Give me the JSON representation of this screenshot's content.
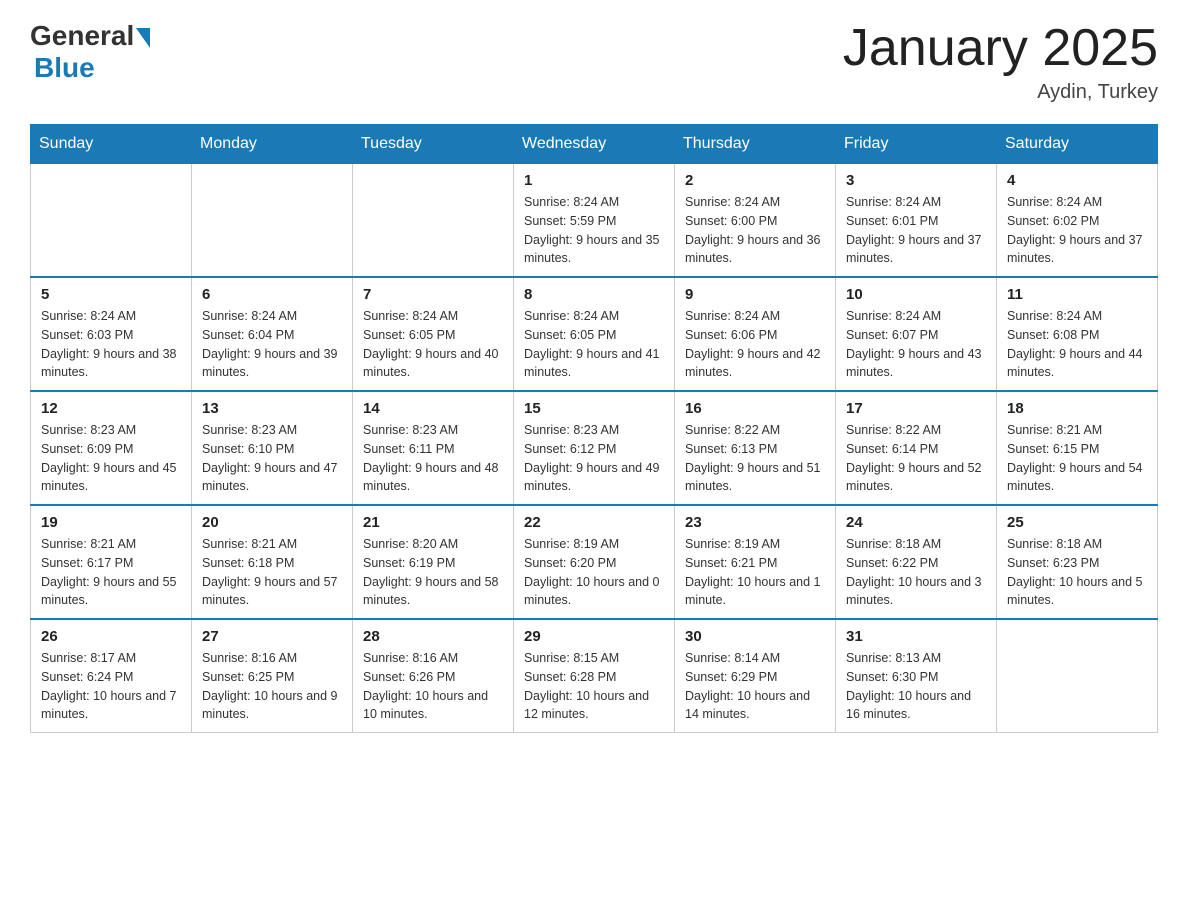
{
  "header": {
    "logo_general": "General",
    "logo_blue": "Blue",
    "month_title": "January 2025",
    "location": "Aydin, Turkey"
  },
  "days_of_week": [
    "Sunday",
    "Monday",
    "Tuesday",
    "Wednesday",
    "Thursday",
    "Friday",
    "Saturday"
  ],
  "weeks": [
    [
      {
        "day": "",
        "info": ""
      },
      {
        "day": "",
        "info": ""
      },
      {
        "day": "",
        "info": ""
      },
      {
        "day": "1",
        "info": "Sunrise: 8:24 AM\nSunset: 5:59 PM\nDaylight: 9 hours and 35 minutes."
      },
      {
        "day": "2",
        "info": "Sunrise: 8:24 AM\nSunset: 6:00 PM\nDaylight: 9 hours and 36 minutes."
      },
      {
        "day": "3",
        "info": "Sunrise: 8:24 AM\nSunset: 6:01 PM\nDaylight: 9 hours and 37 minutes."
      },
      {
        "day": "4",
        "info": "Sunrise: 8:24 AM\nSunset: 6:02 PM\nDaylight: 9 hours and 37 minutes."
      }
    ],
    [
      {
        "day": "5",
        "info": "Sunrise: 8:24 AM\nSunset: 6:03 PM\nDaylight: 9 hours and 38 minutes."
      },
      {
        "day": "6",
        "info": "Sunrise: 8:24 AM\nSunset: 6:04 PM\nDaylight: 9 hours and 39 minutes."
      },
      {
        "day": "7",
        "info": "Sunrise: 8:24 AM\nSunset: 6:05 PM\nDaylight: 9 hours and 40 minutes."
      },
      {
        "day": "8",
        "info": "Sunrise: 8:24 AM\nSunset: 6:05 PM\nDaylight: 9 hours and 41 minutes."
      },
      {
        "day": "9",
        "info": "Sunrise: 8:24 AM\nSunset: 6:06 PM\nDaylight: 9 hours and 42 minutes."
      },
      {
        "day": "10",
        "info": "Sunrise: 8:24 AM\nSunset: 6:07 PM\nDaylight: 9 hours and 43 minutes."
      },
      {
        "day": "11",
        "info": "Sunrise: 8:24 AM\nSunset: 6:08 PM\nDaylight: 9 hours and 44 minutes."
      }
    ],
    [
      {
        "day": "12",
        "info": "Sunrise: 8:23 AM\nSunset: 6:09 PM\nDaylight: 9 hours and 45 minutes."
      },
      {
        "day": "13",
        "info": "Sunrise: 8:23 AM\nSunset: 6:10 PM\nDaylight: 9 hours and 47 minutes."
      },
      {
        "day": "14",
        "info": "Sunrise: 8:23 AM\nSunset: 6:11 PM\nDaylight: 9 hours and 48 minutes."
      },
      {
        "day": "15",
        "info": "Sunrise: 8:23 AM\nSunset: 6:12 PM\nDaylight: 9 hours and 49 minutes."
      },
      {
        "day": "16",
        "info": "Sunrise: 8:22 AM\nSunset: 6:13 PM\nDaylight: 9 hours and 51 minutes."
      },
      {
        "day": "17",
        "info": "Sunrise: 8:22 AM\nSunset: 6:14 PM\nDaylight: 9 hours and 52 minutes."
      },
      {
        "day": "18",
        "info": "Sunrise: 8:21 AM\nSunset: 6:15 PM\nDaylight: 9 hours and 54 minutes."
      }
    ],
    [
      {
        "day": "19",
        "info": "Sunrise: 8:21 AM\nSunset: 6:17 PM\nDaylight: 9 hours and 55 minutes."
      },
      {
        "day": "20",
        "info": "Sunrise: 8:21 AM\nSunset: 6:18 PM\nDaylight: 9 hours and 57 minutes."
      },
      {
        "day": "21",
        "info": "Sunrise: 8:20 AM\nSunset: 6:19 PM\nDaylight: 9 hours and 58 minutes."
      },
      {
        "day": "22",
        "info": "Sunrise: 8:19 AM\nSunset: 6:20 PM\nDaylight: 10 hours and 0 minutes."
      },
      {
        "day": "23",
        "info": "Sunrise: 8:19 AM\nSunset: 6:21 PM\nDaylight: 10 hours and 1 minute."
      },
      {
        "day": "24",
        "info": "Sunrise: 8:18 AM\nSunset: 6:22 PM\nDaylight: 10 hours and 3 minutes."
      },
      {
        "day": "25",
        "info": "Sunrise: 8:18 AM\nSunset: 6:23 PM\nDaylight: 10 hours and 5 minutes."
      }
    ],
    [
      {
        "day": "26",
        "info": "Sunrise: 8:17 AM\nSunset: 6:24 PM\nDaylight: 10 hours and 7 minutes."
      },
      {
        "day": "27",
        "info": "Sunrise: 8:16 AM\nSunset: 6:25 PM\nDaylight: 10 hours and 9 minutes."
      },
      {
        "day": "28",
        "info": "Sunrise: 8:16 AM\nSunset: 6:26 PM\nDaylight: 10 hours and 10 minutes."
      },
      {
        "day": "29",
        "info": "Sunrise: 8:15 AM\nSunset: 6:28 PM\nDaylight: 10 hours and 12 minutes."
      },
      {
        "day": "30",
        "info": "Sunrise: 8:14 AM\nSunset: 6:29 PM\nDaylight: 10 hours and 14 minutes."
      },
      {
        "day": "31",
        "info": "Sunrise: 8:13 AM\nSunset: 6:30 PM\nDaylight: 10 hours and 16 minutes."
      },
      {
        "day": "",
        "info": ""
      }
    ]
  ]
}
